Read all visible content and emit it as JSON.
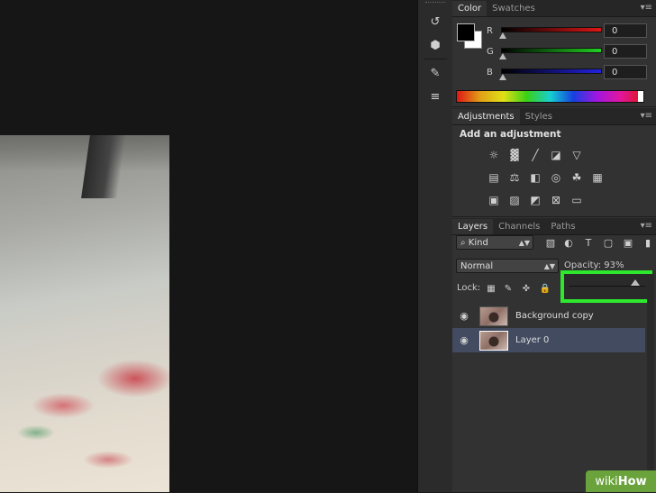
{
  "color_panel": {
    "tabs": [
      "Color",
      "Swatches"
    ],
    "channels": [
      {
        "label": "R",
        "value": "0",
        "gradient": "linear-gradient(90deg,#000,#e01616)"
      },
      {
        "label": "G",
        "value": "0",
        "gradient": "linear-gradient(90deg,#000,#22d022)"
      },
      {
        "label": "B",
        "value": "0",
        "gradient": "linear-gradient(90deg,#000,#2222e0)"
      }
    ],
    "foreground_color": "#000000",
    "background_color": "#ffffff"
  },
  "adjustments_panel": {
    "tabs": [
      "Adjustments",
      "Styles"
    ],
    "title": "Add an adjustment",
    "icons_row1": [
      "brightness-icon",
      "levels-icon",
      "curves-icon",
      "exposure-icon",
      "vibrance-icon"
    ],
    "icons_row2": [
      "hue-saturation-icon",
      "color-balance-icon",
      "black-white-icon",
      "photo-filter-icon",
      "channel-mixer-icon",
      "color-lookup-icon"
    ],
    "icons_row3": [
      "invert-icon",
      "posterize-icon",
      "threshold-icon",
      "selective-color-icon",
      "gradient-map-icon"
    ]
  },
  "layers_panel": {
    "tabs": [
      "Layers",
      "Channels",
      "Paths"
    ],
    "kind_filter": "Kind",
    "blend_mode": "Normal",
    "opacity_label": "Opacity: 93%",
    "lock_label": "Lock:",
    "layers": [
      {
        "name": "Background copy",
        "selected": false
      },
      {
        "name": "Layer 0",
        "selected": true
      }
    ]
  },
  "watermark": {
    "prefix": "wiki",
    "suffix": "How"
  },
  "accent": "#2ee82e"
}
